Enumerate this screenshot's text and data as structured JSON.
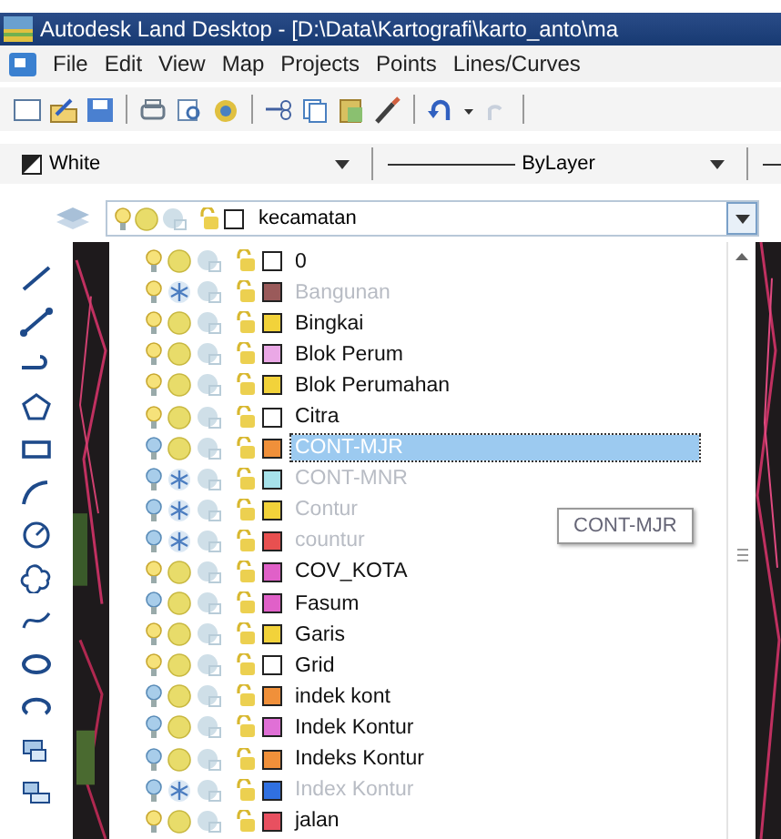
{
  "window": {
    "title": "Autodesk Land Desktop - [D:\\Data\\Kartografi\\karto_anto\\ma"
  },
  "menu": [
    "File",
    "Edit",
    "View",
    "Map",
    "Projects",
    "Points",
    "Lines/Curves"
  ],
  "properties": {
    "color_name": "White",
    "linetype": "ByLayer"
  },
  "current_layer": {
    "name": "kecamatan",
    "on": true,
    "frozen": false,
    "color": "#ffffff"
  },
  "layers": [
    {
      "name": "0",
      "on": true,
      "frozen": false,
      "color": "#ffffff",
      "selected": false
    },
    {
      "name": "Bangunan",
      "on": true,
      "frozen": true,
      "color": "#9a5a5a",
      "selected": false
    },
    {
      "name": "Bingkai",
      "on": true,
      "frozen": false,
      "color": "#f2d23a",
      "selected": false
    },
    {
      "name": "Blok Perum",
      "on": true,
      "frozen": false,
      "color": "#eaa8e6",
      "selected": false
    },
    {
      "name": "Blok Perumahan",
      "on": true,
      "frozen": false,
      "color": "#f2d23a",
      "selected": false
    },
    {
      "name": "Citra",
      "on": true,
      "frozen": false,
      "color": "#ffffff",
      "selected": false
    },
    {
      "name": "CONT-MJR",
      "on": false,
      "frozen": false,
      "color": "#f0903a",
      "selected": true
    },
    {
      "name": "CONT-MNR",
      "on": false,
      "frozen": true,
      "color": "#a6e2ea",
      "selected": false
    },
    {
      "name": "Contur",
      "on": false,
      "frozen": true,
      "color": "#f2d23a",
      "selected": false
    },
    {
      "name": "countur",
      "on": false,
      "frozen": true,
      "color": "#e85050",
      "selected": false
    },
    {
      "name": "COV_KOTA",
      "on": true,
      "frozen": false,
      "color": "#e060c8",
      "selected": false
    },
    {
      "name": "Fasum",
      "on": false,
      "frozen": false,
      "color": "#e060c8",
      "selected": false
    },
    {
      "name": "Garis",
      "on": true,
      "frozen": false,
      "color": "#f2d23a",
      "selected": false
    },
    {
      "name": "Grid",
      "on": true,
      "frozen": false,
      "color": "#ffffff",
      "selected": false
    },
    {
      "name": "indek kont",
      "on": false,
      "frozen": false,
      "color": "#f0903a",
      "selected": false
    },
    {
      "name": "Indek Kontur",
      "on": false,
      "frozen": false,
      "color": "#e070d6",
      "selected": false
    },
    {
      "name": "Indeks Kontur",
      "on": false,
      "frozen": false,
      "color": "#f0903a",
      "selected": false
    },
    {
      "name": "Index Kontur",
      "on": false,
      "frozen": true,
      "color": "#3070e0",
      "selected": false
    },
    {
      "name": "jalan",
      "on": true,
      "frozen": false,
      "color": "#e85060",
      "selected": false
    }
  ],
  "tooltip": "CONT-MJR"
}
